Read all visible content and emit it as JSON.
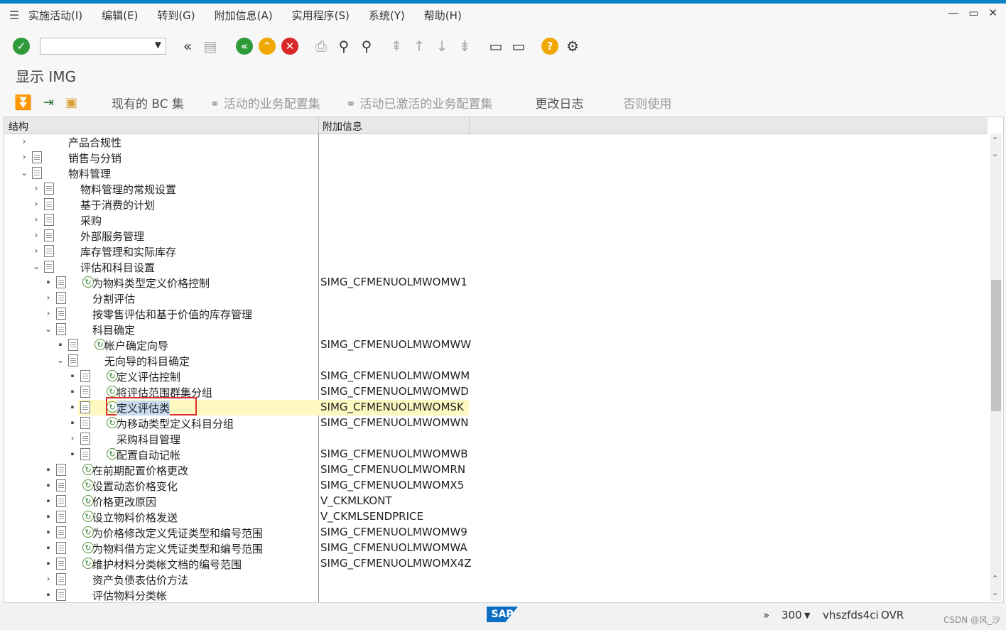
{
  "menu": [
    "实施活动(I)",
    "编辑(E)",
    "转到(G)",
    "附加信息(A)",
    "实用程序(S)",
    "系统(Y)",
    "帮助(H)"
  ],
  "window_controls": [
    "—",
    "▭",
    "✕"
  ],
  "toolbar": {
    "command_value": "",
    "icons": [
      "check-icon",
      "back-double-icon",
      "save-icon",
      "green-back-icon",
      "orange-up-icon",
      "red-cancel-icon",
      "print-icon",
      "find-icon",
      "find-next-icon",
      "first-page-icon",
      "prev-page-icon",
      "next-page-icon",
      "last-page-icon",
      "new-session-icon",
      "shortcut-icon",
      "help-icon",
      "settings-icon"
    ]
  },
  "title": "显示 IMG",
  "appbar": {
    "existing_bc": "现有的 BC 集",
    "active_bc": "活动的业务配置集",
    "activated_bc": "活动已激活的业务配置集",
    "change_log": "更改日志",
    "usage": "否则使用"
  },
  "tree": {
    "col_structure": "结构",
    "col_info": "附加信息",
    "rows": [
      {
        "label": "产品合规性",
        "info": ""
      },
      {
        "label": "销售与分销",
        "info": ""
      },
      {
        "label": "物料管理",
        "info": ""
      },
      {
        "label": "物料管理的常规设置",
        "info": ""
      },
      {
        "label": "基于消费的计划",
        "info": ""
      },
      {
        "label": "采购",
        "info": ""
      },
      {
        "label": "外部服务管理",
        "info": ""
      },
      {
        "label": "库存管理和实际库存",
        "info": ""
      },
      {
        "label": "评估和科目设置",
        "info": ""
      },
      {
        "label": "为物料类型定义价格控制",
        "info": "SIMG_CFMENUOLMWOMW1"
      },
      {
        "label": "分割评估",
        "info": ""
      },
      {
        "label": "按零售评估和基于价值的库存管理",
        "info": ""
      },
      {
        "label": "科目确定",
        "info": ""
      },
      {
        "label": "帐户确定向导",
        "info": "SIMG_CFMENUOLMWOMWW"
      },
      {
        "label": "无向导的科目确定",
        "info": ""
      },
      {
        "label": "定义评估控制",
        "info": "SIMG_CFMENUOLMWOMWM"
      },
      {
        "label": "将评估范围群集分组",
        "info": "SIMG_CFMENUOLMWOMWD"
      },
      {
        "label": "定义评估类",
        "info": "SIMG_CFMENUOLMWOMSK"
      },
      {
        "label": "为移动类型定义科目分组",
        "info": "SIMG_CFMENUOLMWOMWN"
      },
      {
        "label": "采购科目管理",
        "info": ""
      },
      {
        "label": "配置自动记帐",
        "info": "SIMG_CFMENUOLMWOMWB"
      },
      {
        "label": "在前期配置价格更改",
        "info": "SIMG_CFMENUOLMWOMRN"
      },
      {
        "label": "设置动态价格变化",
        "info": "SIMG_CFMENUOLMWOMX5"
      },
      {
        "label": "价格更改原因",
        "info": "V_CKMLKONT"
      },
      {
        "label": "设立物料价格发送",
        "info": "V_CKMLSENDPRICE"
      },
      {
        "label": "为价格修改定义凭证类型和编号范围",
        "info": "SIMG_CFMENUOLMWOMW9"
      },
      {
        "label": "为物料借方定义凭证类型和编号范围",
        "info": "SIMG_CFMENUOLMWOMWA"
      },
      {
        "label": "维护材料分类帐文档的编号范围",
        "info": "SIMG_CFMENUOLMWOMX4Z"
      },
      {
        "label": "资产负债表估价方法",
        "info": ""
      },
      {
        "label": "评估物料分类帐",
        "info": ""
      }
    ]
  },
  "status": {
    "chevron": "»",
    "client": "300",
    "server": "vhszfds4ci",
    "mode": "OVR",
    "logo": "SAP",
    "watermark": "CSDN @风_沙"
  }
}
